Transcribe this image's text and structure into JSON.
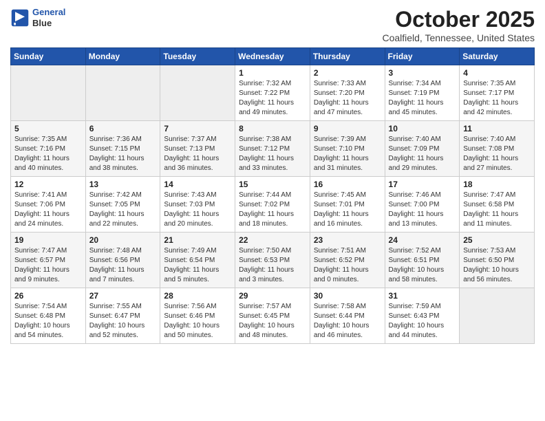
{
  "header": {
    "logo_line1": "General",
    "logo_line2": "Blue",
    "month_title": "October 2025",
    "location": "Coalfield, Tennessee, United States"
  },
  "weekdays": [
    "Sunday",
    "Monday",
    "Tuesday",
    "Wednesday",
    "Thursday",
    "Friday",
    "Saturday"
  ],
  "weeks": [
    [
      {
        "day": "",
        "info": ""
      },
      {
        "day": "",
        "info": ""
      },
      {
        "day": "",
        "info": ""
      },
      {
        "day": "1",
        "info": "Sunrise: 7:32 AM\nSunset: 7:22 PM\nDaylight: 11 hours\nand 49 minutes."
      },
      {
        "day": "2",
        "info": "Sunrise: 7:33 AM\nSunset: 7:20 PM\nDaylight: 11 hours\nand 47 minutes."
      },
      {
        "day": "3",
        "info": "Sunrise: 7:34 AM\nSunset: 7:19 PM\nDaylight: 11 hours\nand 45 minutes."
      },
      {
        "day": "4",
        "info": "Sunrise: 7:35 AM\nSunset: 7:17 PM\nDaylight: 11 hours\nand 42 minutes."
      }
    ],
    [
      {
        "day": "5",
        "info": "Sunrise: 7:35 AM\nSunset: 7:16 PM\nDaylight: 11 hours\nand 40 minutes."
      },
      {
        "day": "6",
        "info": "Sunrise: 7:36 AM\nSunset: 7:15 PM\nDaylight: 11 hours\nand 38 minutes."
      },
      {
        "day": "7",
        "info": "Sunrise: 7:37 AM\nSunset: 7:13 PM\nDaylight: 11 hours\nand 36 minutes."
      },
      {
        "day": "8",
        "info": "Sunrise: 7:38 AM\nSunset: 7:12 PM\nDaylight: 11 hours\nand 33 minutes."
      },
      {
        "day": "9",
        "info": "Sunrise: 7:39 AM\nSunset: 7:10 PM\nDaylight: 11 hours\nand 31 minutes."
      },
      {
        "day": "10",
        "info": "Sunrise: 7:40 AM\nSunset: 7:09 PM\nDaylight: 11 hours\nand 29 minutes."
      },
      {
        "day": "11",
        "info": "Sunrise: 7:40 AM\nSunset: 7:08 PM\nDaylight: 11 hours\nand 27 minutes."
      }
    ],
    [
      {
        "day": "12",
        "info": "Sunrise: 7:41 AM\nSunset: 7:06 PM\nDaylight: 11 hours\nand 24 minutes."
      },
      {
        "day": "13",
        "info": "Sunrise: 7:42 AM\nSunset: 7:05 PM\nDaylight: 11 hours\nand 22 minutes."
      },
      {
        "day": "14",
        "info": "Sunrise: 7:43 AM\nSunset: 7:03 PM\nDaylight: 11 hours\nand 20 minutes."
      },
      {
        "day": "15",
        "info": "Sunrise: 7:44 AM\nSunset: 7:02 PM\nDaylight: 11 hours\nand 18 minutes."
      },
      {
        "day": "16",
        "info": "Sunrise: 7:45 AM\nSunset: 7:01 PM\nDaylight: 11 hours\nand 16 minutes."
      },
      {
        "day": "17",
        "info": "Sunrise: 7:46 AM\nSunset: 7:00 PM\nDaylight: 11 hours\nand 13 minutes."
      },
      {
        "day": "18",
        "info": "Sunrise: 7:47 AM\nSunset: 6:58 PM\nDaylight: 11 hours\nand 11 minutes."
      }
    ],
    [
      {
        "day": "19",
        "info": "Sunrise: 7:47 AM\nSunset: 6:57 PM\nDaylight: 11 hours\nand 9 minutes."
      },
      {
        "day": "20",
        "info": "Sunrise: 7:48 AM\nSunset: 6:56 PM\nDaylight: 11 hours\nand 7 minutes."
      },
      {
        "day": "21",
        "info": "Sunrise: 7:49 AM\nSunset: 6:54 PM\nDaylight: 11 hours\nand 5 minutes."
      },
      {
        "day": "22",
        "info": "Sunrise: 7:50 AM\nSunset: 6:53 PM\nDaylight: 11 hours\nand 3 minutes."
      },
      {
        "day": "23",
        "info": "Sunrise: 7:51 AM\nSunset: 6:52 PM\nDaylight: 11 hours\nand 0 minutes."
      },
      {
        "day": "24",
        "info": "Sunrise: 7:52 AM\nSunset: 6:51 PM\nDaylight: 10 hours\nand 58 minutes."
      },
      {
        "day": "25",
        "info": "Sunrise: 7:53 AM\nSunset: 6:50 PM\nDaylight: 10 hours\nand 56 minutes."
      }
    ],
    [
      {
        "day": "26",
        "info": "Sunrise: 7:54 AM\nSunset: 6:48 PM\nDaylight: 10 hours\nand 54 minutes."
      },
      {
        "day": "27",
        "info": "Sunrise: 7:55 AM\nSunset: 6:47 PM\nDaylight: 10 hours\nand 52 minutes."
      },
      {
        "day": "28",
        "info": "Sunrise: 7:56 AM\nSunset: 6:46 PM\nDaylight: 10 hours\nand 50 minutes."
      },
      {
        "day": "29",
        "info": "Sunrise: 7:57 AM\nSunset: 6:45 PM\nDaylight: 10 hours\nand 48 minutes."
      },
      {
        "day": "30",
        "info": "Sunrise: 7:58 AM\nSunset: 6:44 PM\nDaylight: 10 hours\nand 46 minutes."
      },
      {
        "day": "31",
        "info": "Sunrise: 7:59 AM\nSunset: 6:43 PM\nDaylight: 10 hours\nand 44 minutes."
      },
      {
        "day": "",
        "info": ""
      }
    ]
  ]
}
